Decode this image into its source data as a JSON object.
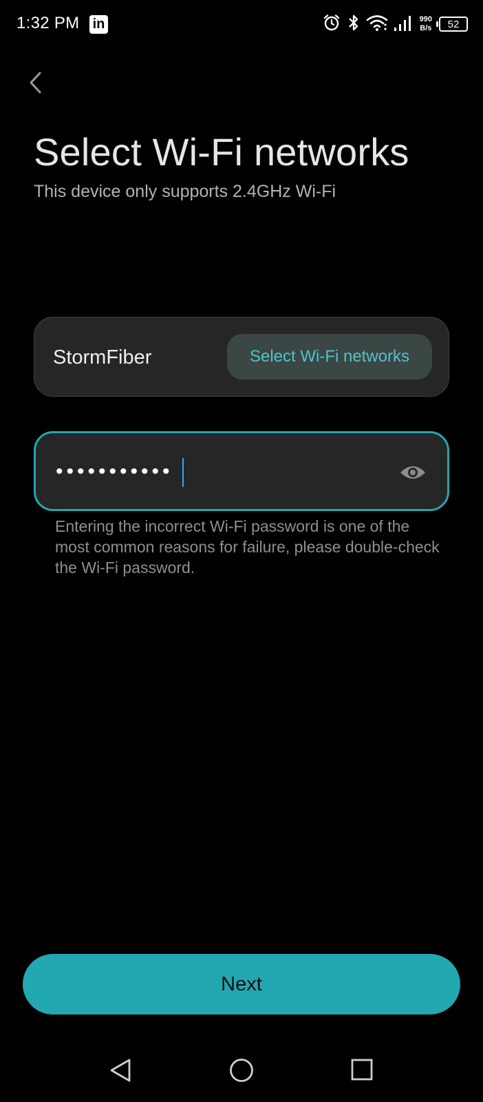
{
  "status_bar": {
    "time": "1:32 PM",
    "app_badge": "in",
    "speed_value": "990",
    "speed_unit": "B/s",
    "battery": "52",
    "icons": [
      "alarm-icon",
      "bluetooth-icon",
      "wifi-icon",
      "signal-icon"
    ]
  },
  "header": {
    "back_icon": "chevron-left-icon",
    "title": "Select Wi-Fi networks",
    "subtitle": "This device only supports 2.4GHz Wi-Fi"
  },
  "network": {
    "name": "StormFiber",
    "select_label": "Select Wi-Fi networks"
  },
  "password": {
    "masked_value": "•••••••••••",
    "visibility_icon": "eye-icon"
  },
  "hint": "Entering the incorrect Wi-Fi password is one of the most common reasons for failure, please double-check the Wi-Fi password.",
  "actions": {
    "next_label": "Next"
  },
  "navigation": {
    "icons": [
      "nav-back-icon",
      "nav-home-icon",
      "nav-recents-icon"
    ]
  },
  "colors": {
    "accent": "#23a7b0",
    "accent_text": "#4fc3c8",
    "background": "#000000",
    "card": "#262626"
  }
}
